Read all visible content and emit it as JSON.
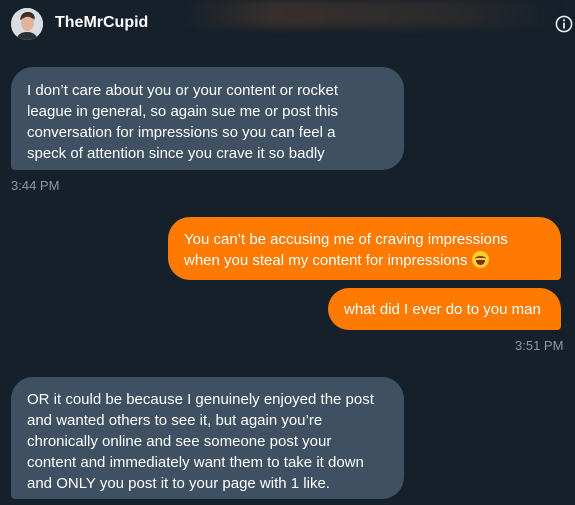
{
  "header": {
    "contact_name": "TheMrCupid",
    "avatar_icon": "user-avatar",
    "info_icon": "info-icon"
  },
  "messages": [
    {
      "direction": "received",
      "lines": [
        "I don’t care about you or your content or rocket",
        "league in general, so again sue me or post this",
        "conversation for impressions so you can feel a",
        "speck of attention since you crave it so badly"
      ],
      "time": "3:44 PM"
    },
    {
      "direction": "sent",
      "lines": [
        "You can’t be accusing me of craving impressions",
        "when you steal my content for impressions"
      ],
      "emoji": "face-with-tears-of-joy"
    },
    {
      "direction": "sent",
      "lines": [
        "what did I ever do to you man"
      ],
      "time": "3:51 PM"
    },
    {
      "direction": "received",
      "lines": [
        "OR it could be because I genuinely enjoyed the post",
        "and wanted others to see it, but again you’re",
        "chronically online and see someone post your",
        "content and immediately want them to take it down",
        "and ONLY you post it to your page with 1 like."
      ]
    }
  ],
  "colors": {
    "background": "#15202b",
    "received_bubble": "#3e5061",
    "sent_bubble": "#ff7a00",
    "timestamp": "#8b98a5"
  }
}
